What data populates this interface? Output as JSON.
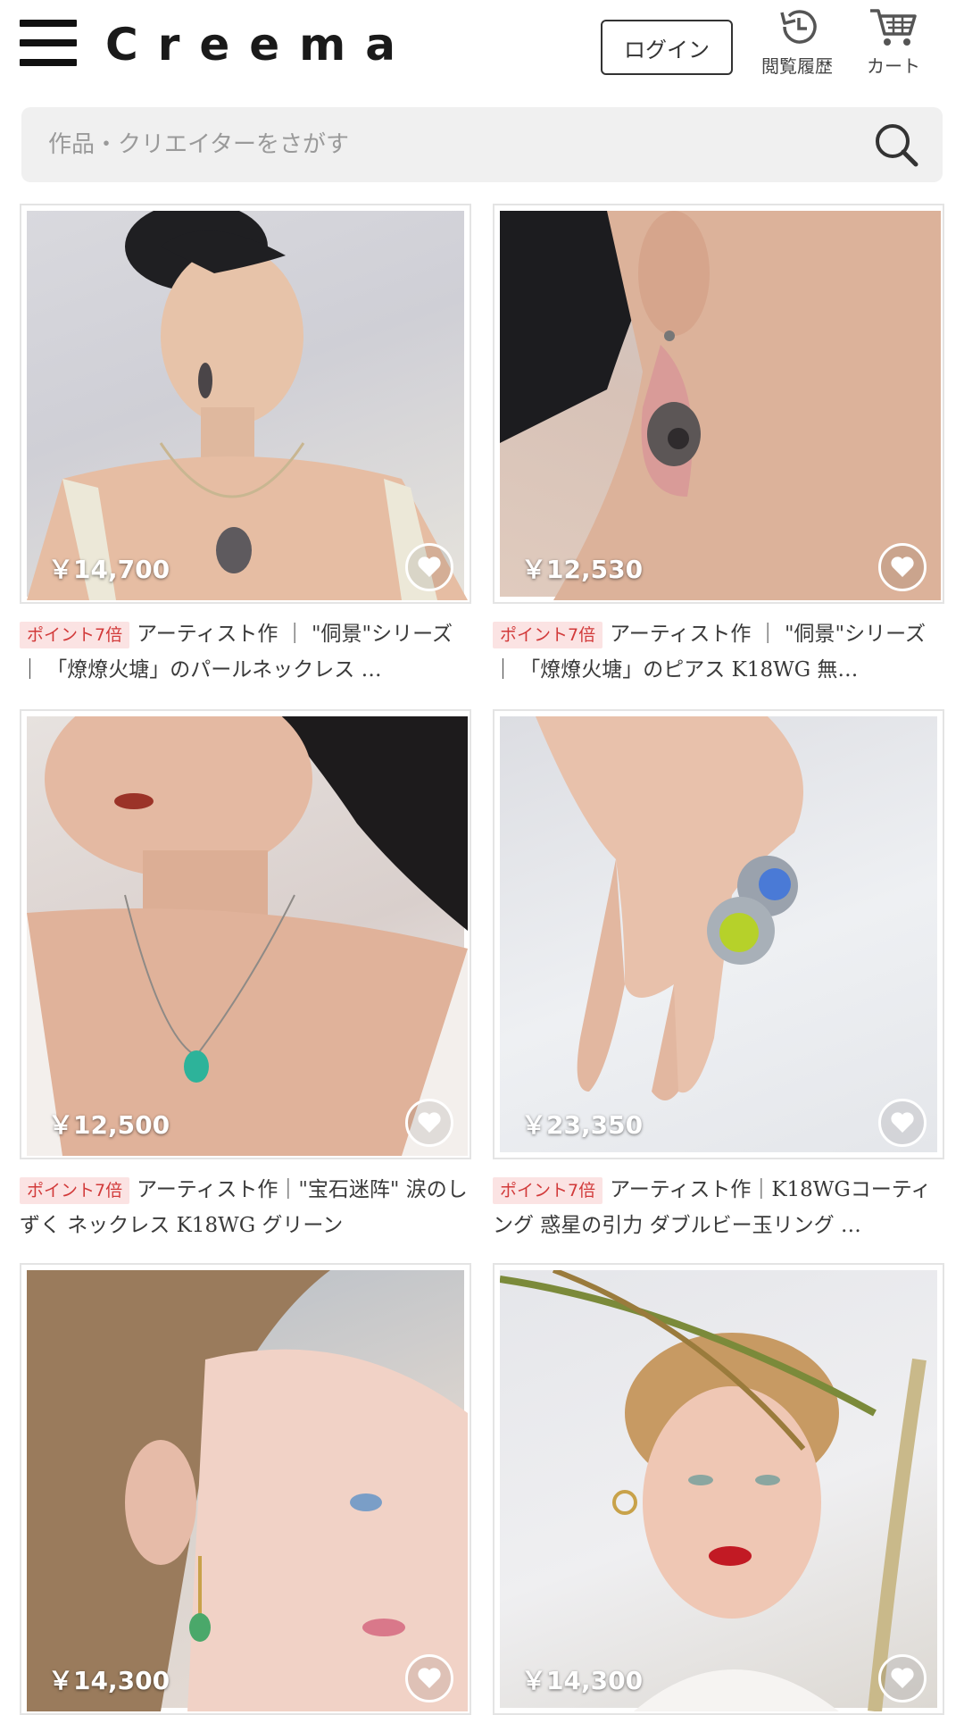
{
  "header": {
    "logo": "Creema",
    "login_label": "ログイン",
    "history_label": "閲覧履歴",
    "cart_label": "カート"
  },
  "search": {
    "placeholder": "作品・クリエイターをさがす"
  },
  "colors": {
    "badge_bg": "#fbe3e3",
    "badge_text": "#d23a3a"
  },
  "products": [
    {
      "price": "￥14,700",
      "badge": "ポイント7倍",
      "title": "アーティスト作 ｜ \"侗景\"シリーズ ｜ 「燎燎火塘」のパールネックレス …"
    },
    {
      "price": "￥12,530",
      "badge": "ポイント7倍",
      "title": "アーティスト作 ｜ \"侗景\"シリーズ ｜ 「燎燎火塘」のピアス K18WG 無…"
    },
    {
      "price": "￥12,500",
      "badge": "ポイント7倍",
      "title": "アーティスト作｜\"宝石迷阵\" 涙のしずく ネックレス K18WG グリーン"
    },
    {
      "price": "￥23,350",
      "badge": "ポイント7倍",
      "title": "アーティスト作｜K18WGコーティング 惑星の引力 ダブルビー玉リング …"
    },
    {
      "price": "￥14,300",
      "badge": "",
      "title": ""
    },
    {
      "price": "￥14,300",
      "badge": "",
      "title": ""
    }
  ]
}
